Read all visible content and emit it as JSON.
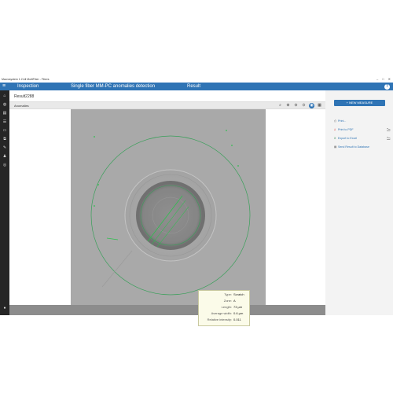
{
  "window": {
    "title": "Macrosystem 1.2 All MultiFiber - Fibers",
    "controls": [
      "–",
      "□",
      "✕"
    ]
  },
  "appbar": {
    "menu_icon": "hamburger-icon",
    "breadcrumb_inspection": "Inspection",
    "breadcrumb_analysis": "Single fiber MM-PC anomalies detection",
    "breadcrumb_result": "Result",
    "help_label": "?"
  },
  "sidebar": {
    "items": [
      {
        "name": "home-icon",
        "glyph": "⌂"
      },
      {
        "name": "globe-icon",
        "glyph": "◍"
      },
      {
        "name": "book-icon",
        "glyph": "▤"
      },
      {
        "name": "list-icon",
        "glyph": "☰"
      },
      {
        "name": "folder-icon",
        "glyph": "▭"
      },
      {
        "name": "layers-icon",
        "glyph": "⧉"
      },
      {
        "name": "tools-icon",
        "glyph": "✎"
      },
      {
        "name": "users-icon",
        "glyph": "♟"
      },
      {
        "name": "target-icon",
        "glyph": "◎"
      }
    ],
    "user_glyph": "●"
  },
  "main": {
    "result_title": "Result2288",
    "tab_label": "Anomalies",
    "toolbar": [
      {
        "name": "zoom-fit-icon",
        "glyph": "⌕"
      },
      {
        "name": "zoom-in-icon",
        "glyph": "⊕"
      },
      {
        "name": "zoom-out-icon",
        "glyph": "⊖"
      },
      {
        "name": "zoom-reset-icon",
        "glyph": "⊙"
      },
      {
        "name": "overlay-toggle-icon",
        "glyph": "◉",
        "active": true
      },
      {
        "name": "export-image-icon",
        "glyph": "▦"
      }
    ]
  },
  "tooltip": {
    "rows": [
      {
        "key": "Type:",
        "value": "Scratch"
      },
      {
        "key": "Zone:",
        "value": "A"
      },
      {
        "key": "Length:",
        "value": "73 µm"
      },
      {
        "key": "Average width:",
        "value": "0.6 µm"
      },
      {
        "key": "Relative intensity:",
        "value": "0.011"
      }
    ]
  },
  "rightpanel": {
    "new_measure": "+ NEW MEASURE",
    "actions": [
      {
        "name": "print-action",
        "icon": "printer-icon",
        "glyph": "⎙",
        "label": "Print...",
        "folder": false
      },
      {
        "name": "export-pdf-action",
        "icon": "pdf-icon",
        "glyph": "⅄",
        "label": "Print to PDF",
        "folder": true
      },
      {
        "name": "export-excel-action",
        "icon": "excel-icon",
        "glyph": "X",
        "label": "Export to Excel",
        "folder": true
      },
      {
        "name": "send-database-action",
        "icon": "database-icon",
        "glyph": "▤",
        "label": "Send Result to Database",
        "folder": false
      }
    ],
    "folder_glyph": "🗀"
  },
  "colors": {
    "accent": "#2f74b5",
    "sidebar": "#262626",
    "zone_ring": "#3aa05a",
    "anomaly": "#2fbf4f"
  }
}
